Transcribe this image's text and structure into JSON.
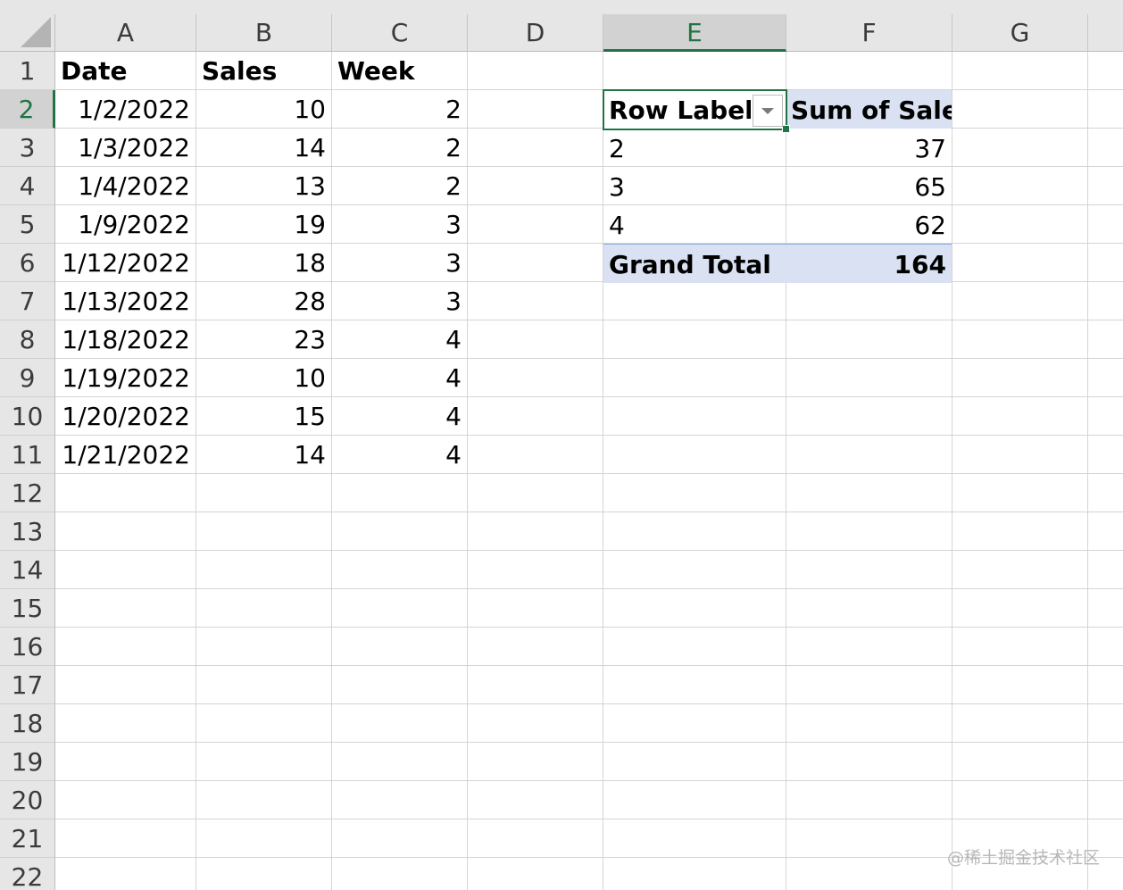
{
  "columns": [
    "A",
    "B",
    "C",
    "D",
    "E",
    "F",
    "G"
  ],
  "selected_column": "E",
  "rows": [
    "1",
    "2",
    "3",
    "4",
    "5",
    "6",
    "7",
    "8",
    "9",
    "10",
    "11",
    "12",
    "13",
    "14",
    "15",
    "16",
    "17",
    "18",
    "19",
    "20",
    "21",
    "22"
  ],
  "selected_row": "2",
  "data_table": {
    "headers": [
      "Date",
      "Sales",
      "Week"
    ],
    "rows": [
      [
        "1/2/2022",
        "10",
        "2"
      ],
      [
        "1/3/2022",
        "14",
        "2"
      ],
      [
        "1/4/2022",
        "13",
        "2"
      ],
      [
        "1/9/2022",
        "19",
        "3"
      ],
      [
        "1/12/2022",
        "18",
        "3"
      ],
      [
        "1/13/2022",
        "28",
        "3"
      ],
      [
        "1/18/2022",
        "23",
        "4"
      ],
      [
        "1/19/2022",
        "10",
        "4"
      ],
      [
        "1/20/2022",
        "15",
        "4"
      ],
      [
        "1/21/2022",
        "14",
        "4"
      ]
    ]
  },
  "pivot": {
    "row_labels_header": "Row Labels",
    "value_header": "Sum of Sales",
    "rows": [
      [
        "2",
        "37"
      ],
      [
        "3",
        "65"
      ],
      [
        "4",
        "62"
      ]
    ],
    "grand_total_label": "Grand Total",
    "grand_total_value": "164",
    "filter_icon": "dropdown-arrow-icon"
  },
  "watermark": "@稀土掘金技术社区",
  "colors": {
    "accent": "#217346",
    "pivot_header_bg": "#d9e1f2",
    "header_bg": "#e6e6e6"
  }
}
